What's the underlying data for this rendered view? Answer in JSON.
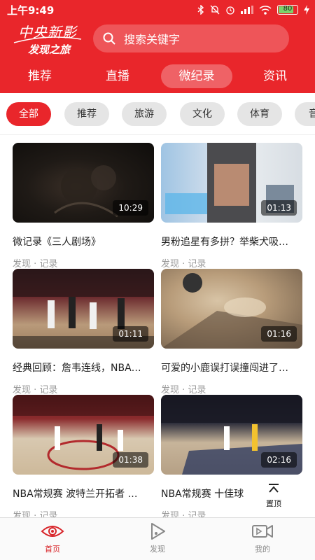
{
  "status_bar": {
    "time": "上午9:49",
    "battery": "80",
    "battery_level": 0.8
  },
  "header": {
    "logo_line1": "中央新影",
    "logo_line2": "发现之旅",
    "search_placeholder": "搜索关键字",
    "tabs": [
      {
        "label": "推荐"
      },
      {
        "label": "直播"
      },
      {
        "label": "微纪录",
        "active": true
      },
      {
        "label": "资讯"
      }
    ]
  },
  "categories": [
    {
      "label": "全部",
      "active": true
    },
    {
      "label": "推荐"
    },
    {
      "label": "旅游"
    },
    {
      "label": "文化"
    },
    {
      "label": "体育"
    },
    {
      "label": "音"
    }
  ],
  "videos": [
    {
      "title": "微记录《三人剧场》",
      "meta": "发现 · 记录",
      "duration": "10:29"
    },
    {
      "title": "男粉追星有多拼？举柴犬吸…",
      "meta": "发现 · 记录",
      "duration": "01:13"
    },
    {
      "title": "经典回顾：詹韦连线，NBA…",
      "meta": "发现 · 记录",
      "duration": "01:11"
    },
    {
      "title": "可爱的小鹿误打误撞闯进了…",
      "meta": "发现 · 记录",
      "duration": "01:16"
    },
    {
      "title": "NBA常规赛 波特兰开拓者 …",
      "meta": "发现 · 记录",
      "duration": "01:38"
    },
    {
      "title": "NBA常规赛 十佳球",
      "meta": "发现 · 记录",
      "duration": "02:16"
    }
  ],
  "back_to_top": {
    "label": "置顶"
  },
  "bottom_nav": [
    {
      "label": "首页",
      "icon": "eye-icon",
      "active": true
    },
    {
      "label": "发现",
      "icon": "play-icon"
    },
    {
      "label": "我的",
      "icon": "video-camera-icon"
    }
  ]
}
